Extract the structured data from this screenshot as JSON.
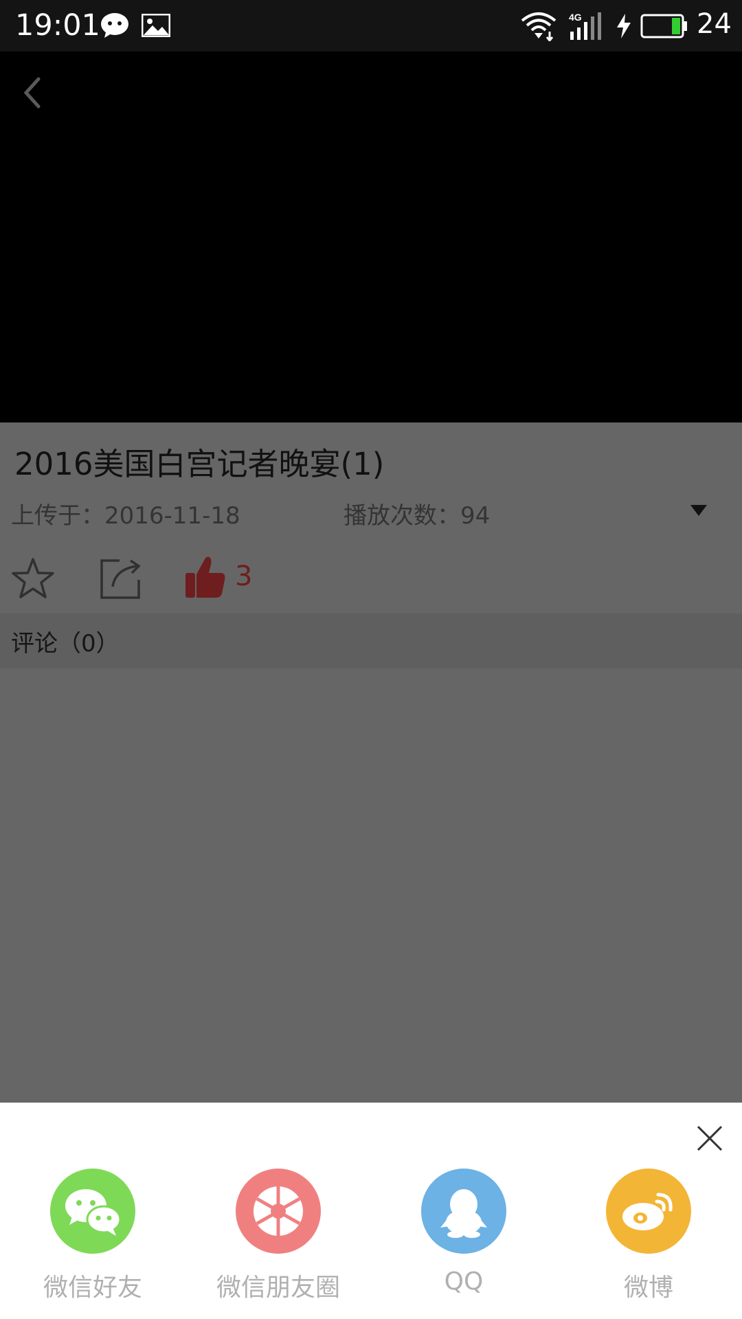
{
  "status_bar": {
    "time": "19:01",
    "network": "4G",
    "battery_level": "24",
    "icons": [
      "wechat-notification-icon",
      "gallery-notification-icon",
      "wifi-icon",
      "signal-icon",
      "charging-icon",
      "battery-icon"
    ]
  },
  "video": {
    "title": "2016美国白宫记者晚宴(1)",
    "upload_label": "上传于：2016-11-18",
    "plays_label": "播放次数：94",
    "like_count": "3"
  },
  "comments": {
    "label": "评论（0）"
  },
  "share_sheet": {
    "items": [
      {
        "label": "微信好友",
        "color": "#7ed957",
        "icon": "wechat-icon"
      },
      {
        "label": "微信朋友圈",
        "color": "#f08080",
        "icon": "moments-icon"
      },
      {
        "label": "QQ",
        "color": "#6cb2e4",
        "icon": "qq-icon"
      },
      {
        "label": "微博",
        "color": "#f3b536",
        "icon": "weibo-icon"
      }
    ]
  },
  "colors": {
    "overlay_bg": "#666666",
    "like_red": "#6e1e1e",
    "status_bar": "#141414"
  }
}
